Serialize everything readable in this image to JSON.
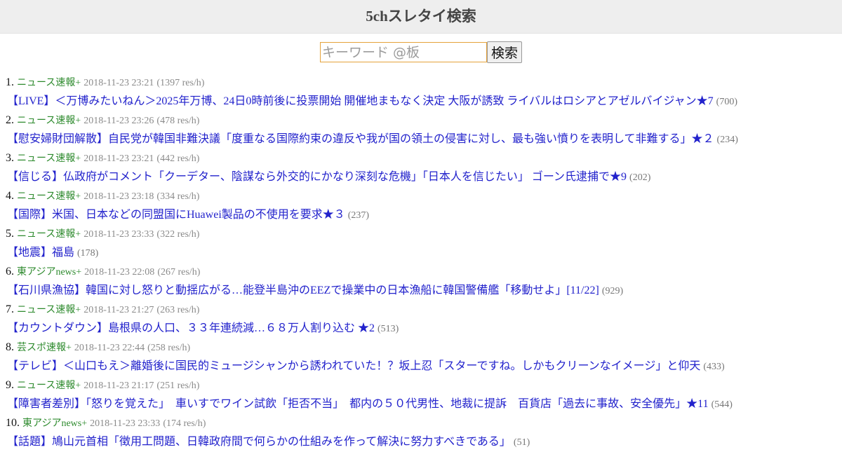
{
  "header": {
    "title": "5chスレタイ検索"
  },
  "search": {
    "placeholder": "キーワード @板",
    "value": "",
    "button_label": "検索"
  },
  "results": [
    {
      "rank": "1.",
      "board": "ニュース速報+",
      "date": "2018-11-23 23:21",
      "rate": "(1397 res/h)",
      "title": "【LIVE】＜万博みたいねん＞2025年万博、24日0時前後に投票開始 開催地まもなく決定 大阪が誘致 ライバルはロシアとアゼルバイジャン★7",
      "count": "(700)"
    },
    {
      "rank": "2.",
      "board": "ニュース速報+",
      "date": "2018-11-23 23:26",
      "rate": "(478 res/h)",
      "title": "【慰安婦財団解散】自民党が韓国非難決議「度重なる国際約束の違反や我が国の領土の侵害に対し、最も強い憤りを表明して非難する」★２",
      "count": "(234)"
    },
    {
      "rank": "3.",
      "board": "ニュース速報+",
      "date": "2018-11-23 23:21",
      "rate": "(442 res/h)",
      "title": "【信じる】仏政府がコメント「クーデター、陰謀なら外交的にかなり深刻な危機」「日本人を信じたい」 ゴーン氏逮捕で★9",
      "count": "(202)"
    },
    {
      "rank": "4.",
      "board": "ニュース速報+",
      "date": "2018-11-23 23:18",
      "rate": "(334 res/h)",
      "title": "【国際】米国、日本などの同盟国にHuawei製品の不使用を要求★３",
      "count": "(237)"
    },
    {
      "rank": "5.",
      "board": "ニュース速報+",
      "date": "2018-11-23 23:33",
      "rate": "(322 res/h)",
      "title": "【地震】福島",
      "count": "(178)"
    },
    {
      "rank": "6.",
      "board": "東アジアnews+",
      "date": "2018-11-23 22:08",
      "rate": "(267 res/h)",
      "title": "【石川県漁協】韓国に対し怒りと動揺広がる…能登半島沖のEEZで操業中の日本漁船に韓国警備艦「移動せよ」[11/22]",
      "count": "(929)"
    },
    {
      "rank": "7.",
      "board": "ニュース速報+",
      "date": "2018-11-23 21:27",
      "rate": "(263 res/h)",
      "title": "【カウントダウン】島根県の人口、３３年連続減…６８万人割り込む ★2",
      "count": "(513)"
    },
    {
      "rank": "8.",
      "board": "芸スポ速報+",
      "date": "2018-11-23 22:44",
      "rate": "(258 res/h)",
      "title": "【テレビ】＜山口もえ＞離婚後に国民的ミュージシャンから誘われていた！？坂上忍「スターですね。しかもクリーンなイメージ」と仰天",
      "count": "(433)"
    },
    {
      "rank": "9.",
      "board": "ニュース速報+",
      "date": "2018-11-23 21:17",
      "rate": "(251 res/h)",
      "title": "【障害者差別】「怒りを覚えた」　車いすでワイン試飲「拒否不当」　都内の５０代男性、地裁に提訴　百貨店「過去に事故、安全優先」★11",
      "count": "(544)"
    },
    {
      "rank": "10.",
      "board": "東アジアnews+",
      "date": "2018-11-23 23:33",
      "rate": "(174 res/h)",
      "title": "【話題】鳩山元首相「徴用工問題、日韓政府間で何らかの仕組みを作って解決に努力すべきである」",
      "count": "(51)"
    }
  ]
}
